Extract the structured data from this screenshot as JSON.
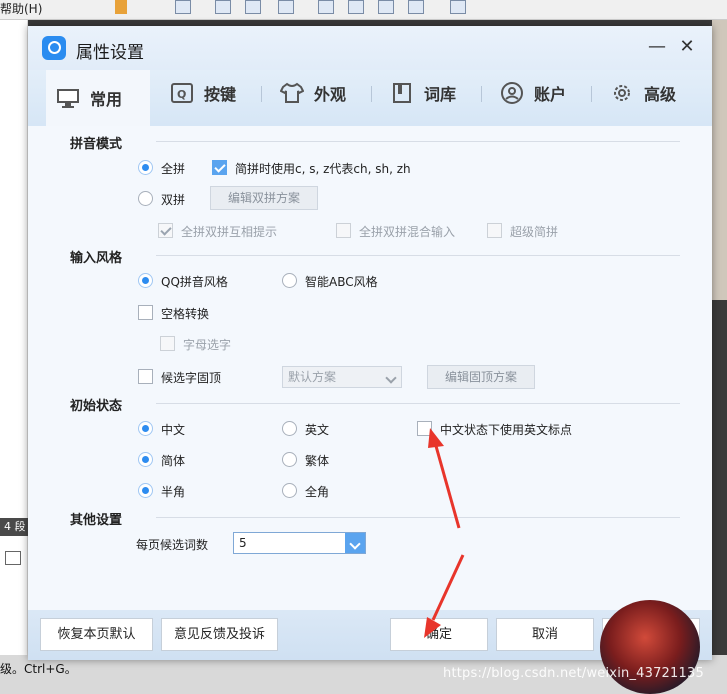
{
  "background": {
    "menu_text": "帮助(H)",
    "left_tag": "4 段",
    "bottom_text": "级。Ctrl+G。",
    "watermark": "https://blog.csdn.net/weixin_43721135"
  },
  "dialog": {
    "title": "属性设置",
    "minimize_glyph": "—",
    "close_glyph": "✕"
  },
  "tabs": [
    {
      "label": "常用",
      "icon": "monitor-icon",
      "active": true
    },
    {
      "label": "按键",
      "icon": "key-icon",
      "active": false
    },
    {
      "label": "外观",
      "icon": "tshirt-icon",
      "active": false
    },
    {
      "label": "词库",
      "icon": "book-icon",
      "active": false
    },
    {
      "label": "账户",
      "icon": "user-icon",
      "active": false
    },
    {
      "label": "高级",
      "icon": "gear-icon",
      "active": false
    }
  ],
  "pinyin_mode": {
    "title": "拼音模式",
    "full": "全拼",
    "full_checked": true,
    "abbr": "简拼时使用c, s, z代表ch, sh, zh",
    "abbr_checked": true,
    "double": "双拼",
    "double_checked": false,
    "edit_double_btn": "编辑双拼方案",
    "mutual_hint": "全拼双拼互相提示",
    "mutual_hint_checked": true,
    "mixed_input": "全拼双拼混合输入",
    "mixed_input_checked": false,
    "super_abbr": "超级简拼",
    "super_abbr_checked": false
  },
  "input_style": {
    "title": "输入风格",
    "qq_style": "QQ拼音风格",
    "qq_style_checked": true,
    "abc_style": "智能ABC风格",
    "abc_style_checked": false,
    "space_convert": "空格转换",
    "space_convert_checked": false,
    "letter_select": "字母选字",
    "letter_select_checked": false,
    "fix_top": "候选字固顶",
    "fix_top_checked": false,
    "default_scheme": "默认方案",
    "edit_fix_btn": "编辑固顶方案"
  },
  "initial_state": {
    "title": "初始状态",
    "chinese": "中文",
    "chinese_checked": true,
    "english": "英文",
    "english_checked": false,
    "eng_punct": "中文状态下使用英文标点",
    "eng_punct_checked": false,
    "simplified": "简体",
    "simplified_checked": true,
    "traditional": "繁体",
    "traditional_checked": false,
    "half_width": "半角",
    "half_width_checked": true,
    "full_width": "全角",
    "full_width_checked": false
  },
  "other": {
    "title": "其他设置",
    "per_page_label": "每页候选词数",
    "per_page_value": "5"
  },
  "footer": {
    "restore": "恢复本页默认",
    "feedback": "意见反馈及投诉",
    "ok": "确定",
    "cancel": "取消"
  },
  "colors": {
    "accent": "#2d8cf0",
    "annotation_arrow": "#e8352b"
  }
}
